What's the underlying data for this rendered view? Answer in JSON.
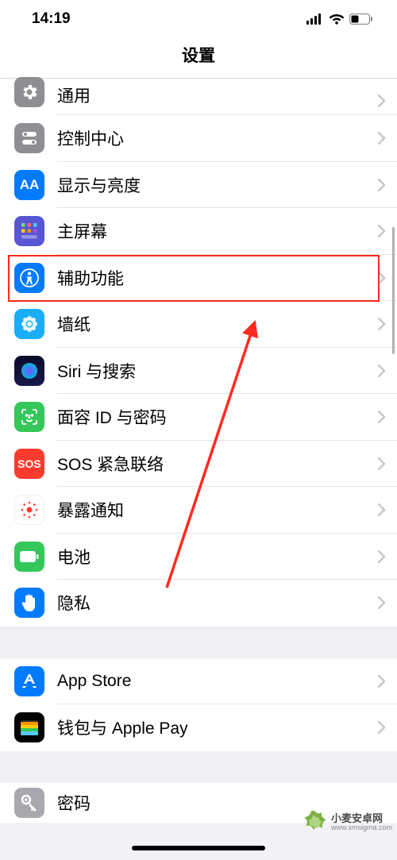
{
  "status": {
    "time": "14:19"
  },
  "header": {
    "title": "设置"
  },
  "groups": [
    [
      {
        "key": "general",
        "label": "通用"
      },
      {
        "key": "control",
        "label": "控制中心"
      },
      {
        "key": "display",
        "label": "显示与亮度"
      },
      {
        "key": "home",
        "label": "主屏幕"
      },
      {
        "key": "accessibility",
        "label": "辅助功能"
      },
      {
        "key": "wallpaper",
        "label": "墙纸"
      },
      {
        "key": "siri",
        "label": "Siri 与搜索"
      },
      {
        "key": "faceid",
        "label": "面容 ID 与密码"
      },
      {
        "key": "sos",
        "label": "SOS 紧急联络"
      },
      {
        "key": "exposure",
        "label": "暴露通知"
      },
      {
        "key": "battery",
        "label": "电池"
      },
      {
        "key": "privacy",
        "label": "隐私"
      }
    ],
    [
      {
        "key": "appstore",
        "label": "App Store"
      },
      {
        "key": "wallet",
        "label": "钱包与 Apple Pay"
      }
    ],
    [
      {
        "key": "passwords",
        "label": "密码"
      }
    ]
  ],
  "highlighted_row": "accessibility",
  "watermark": {
    "line1": "小麦安卓网",
    "line2": "www.xmsigma.com"
  }
}
